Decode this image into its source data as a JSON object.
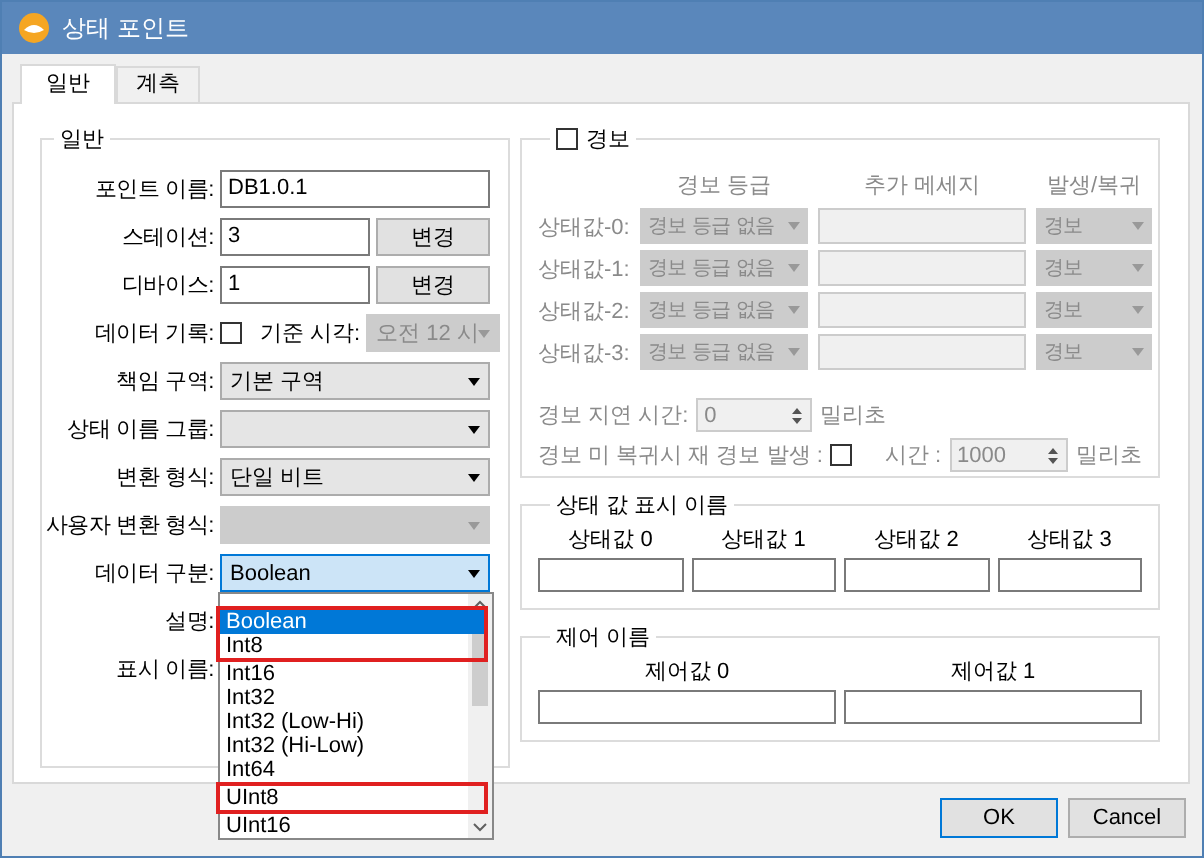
{
  "window": {
    "title": "상태 포인트"
  },
  "tabs": [
    {
      "label": "일반",
      "selected": true
    },
    {
      "label": "계측",
      "selected": false
    }
  ],
  "general": {
    "title": "일반",
    "fields": [
      {
        "kind": "text",
        "label": "포인트 이름:",
        "value": "DB1.0.1"
      },
      {
        "kind": "text_button",
        "label": "스테이션:",
        "value": "3",
        "button": "변경"
      },
      {
        "kind": "text_button",
        "label": "디바이스:",
        "value": "1",
        "button": "변경"
      },
      {
        "kind": "checkbox_time",
        "label": "데이터 기록:",
        "checked": false,
        "time_label": "기준 시각:",
        "time_value": "오전 12 시"
      },
      {
        "kind": "combo",
        "label": "책임 구역:",
        "value": "기본 구역",
        "disabled": false,
        "open": false
      },
      {
        "kind": "combo",
        "label": "상태 이름 그룹:",
        "disabled": false,
        "open": false
      },
      {
        "kind": "combo",
        "label": "변환 형식:",
        "value": "단일 비트",
        "disabled": false,
        "open": false
      },
      {
        "kind": "combo",
        "label": "사용자 변환 형식:",
        "disabled": true,
        "open": false
      },
      {
        "kind": "combo",
        "label": "데이터 구분:",
        "value": "Boolean",
        "disabled": false,
        "open": true
      },
      {
        "kind": "label",
        "label": "설명:"
      },
      {
        "kind": "label",
        "label": "표시 이름:"
      }
    ]
  },
  "dropdown": {
    "items": [
      {
        "label": "Boolean",
        "selected": true,
        "highlighted": true
      },
      {
        "label": "Int8",
        "selected": false,
        "highlighted": true
      },
      {
        "label": "Int16",
        "selected": false,
        "highlighted": false
      },
      {
        "label": "Int32",
        "selected": false,
        "highlighted": false
      },
      {
        "label": "Int32 (Low-Hi)",
        "selected": false,
        "highlighted": false
      },
      {
        "label": "Int32 (Hi-Low)",
        "selected": false,
        "highlighted": false
      },
      {
        "label": "Int64",
        "selected": false,
        "highlighted": false
      },
      {
        "label": "UInt8",
        "selected": false,
        "highlighted": true
      },
      {
        "label": "UInt16",
        "selected": false,
        "highlighted": false
      }
    ]
  },
  "alarm": {
    "title": "경보",
    "checked": false,
    "columns": [
      "경보 등급",
      "추가 메세지",
      "발생/복귀"
    ],
    "rows": [
      {
        "label": "상태값-0:",
        "grade": "경보 등급 없음",
        "action": "경보"
      },
      {
        "label": "상태값-1:",
        "grade": "경보 등급 없음",
        "action": "경보"
      },
      {
        "label": "상태값-2:",
        "grade": "경보 등급 없음",
        "action": "경보"
      },
      {
        "label": "상태값-3:",
        "grade": "경보 등급 없음",
        "action": "경보"
      }
    ],
    "delay_label": "경보 지연 시간:",
    "delay_value": "0",
    "delay_unit": "밀리초",
    "repeat_label": "경보 미 복귀시 재 경보 발생 :",
    "repeat_checked": false,
    "repeat_time_label": "시간 :",
    "repeat_time_value": "1000",
    "repeat_unit": "밀리초"
  },
  "state_names": {
    "title": "상태 값 표시 이름",
    "labels": [
      "상태값 0",
      "상태값 1",
      "상태값 2",
      "상태값 3"
    ]
  },
  "control_names": {
    "title": "제어 이름",
    "labels": [
      "제어값 0",
      "제어값 1"
    ]
  },
  "buttons": [
    {
      "label": "OK",
      "default": true
    },
    {
      "label": "Cancel",
      "default": false
    }
  ]
}
